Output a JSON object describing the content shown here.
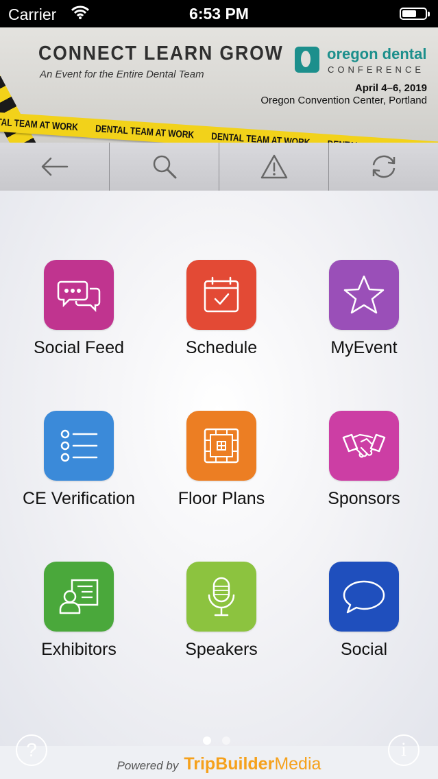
{
  "status_bar": {
    "carrier": "Carrier",
    "time": "6:53 PM"
  },
  "banner": {
    "tagline": "CONNECT  LEARN  GROW",
    "subtagline": "An Event for the Entire Dental Team",
    "org_name": "oregon dental",
    "org_sub": "CONFERENCE",
    "dates": "April 4–6, 2019",
    "venue": "Oregon Convention Center, Portland",
    "tape_text": "DENTAL TEAM AT WORK"
  },
  "toolbar": {
    "icons": [
      "back-arrow-icon",
      "search-icon",
      "warning-icon",
      "refresh-icon"
    ]
  },
  "tiles": [
    {
      "label": "Social Feed",
      "color": "#c0348f",
      "icon": "chat-bubbles-icon"
    },
    {
      "label": "Schedule",
      "color": "#e34a35",
      "icon": "calendar-check-icon"
    },
    {
      "label": "MyEvent",
      "color": "#9a4fb8",
      "icon": "star-icon"
    },
    {
      "label": "CE Verification",
      "color": "#3b8ad9",
      "icon": "list-icon"
    },
    {
      "label": "Floor Plans",
      "color": "#ec7e23",
      "icon": "floor-plan-icon"
    },
    {
      "label": "Sponsors",
      "color": "#cc3ea4",
      "icon": "handshake-icon"
    },
    {
      "label": "Exhibitors",
      "color": "#4aa83b",
      "icon": "exhibitor-icon"
    },
    {
      "label": "Speakers",
      "color": "#8cc33f",
      "icon": "microphone-icon"
    },
    {
      "label": "Social",
      "color": "#1f4fbd",
      "icon": "speech-bubble-icon"
    }
  ],
  "footer": {
    "help_glyph": "?",
    "info_glyph": "i",
    "powered_by": "Powered by",
    "brand_bold": "TripBuilder",
    "brand_light": "Media"
  }
}
